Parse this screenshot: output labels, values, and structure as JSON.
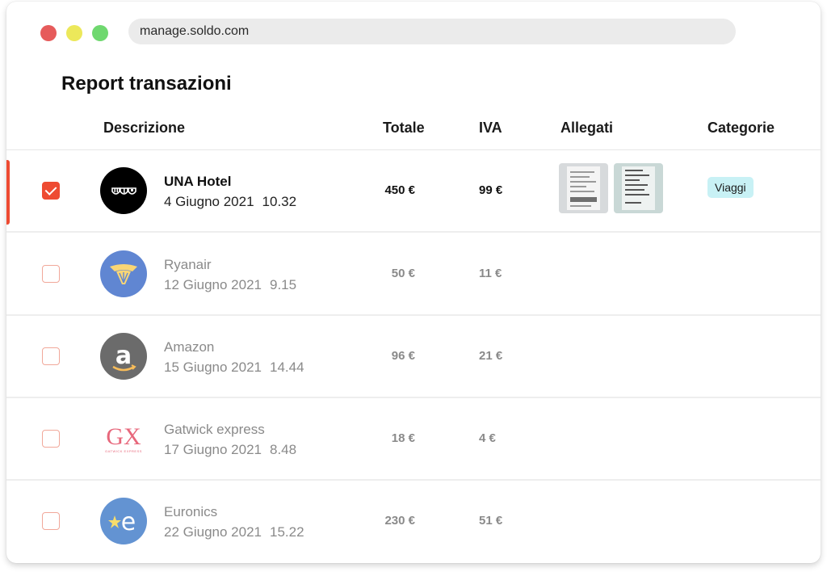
{
  "browser": {
    "url": "manage.soldo.com",
    "dots": {
      "red": "#e65b5b",
      "yellow": "#ece85a",
      "green": "#6fd86f"
    }
  },
  "page": {
    "title": "Report transazioni"
  },
  "table": {
    "headers": {
      "description": "Descrizione",
      "total": "Totale",
      "vat": "IVA",
      "attachments": "Allegati",
      "categories": "Categorie"
    },
    "rows": [
      {
        "merchant": "UNA Hotel",
        "date": "4 Giugno 2021",
        "time": "10.32",
        "total": "450 €",
        "vat": "99 €",
        "selected": true,
        "logo": "una-hotel-logo",
        "attachments": [
          "receipt-thumbnail",
          "receipt-thumbnail"
        ],
        "category": "Viaggi"
      },
      {
        "merchant": "Ryanair",
        "date": "12 Giugno 2021",
        "time": "9.15",
        "total": "50 €",
        "vat": "11 €",
        "selected": false,
        "logo": "ryanair-logo"
      },
      {
        "merchant": "Amazon",
        "date": "15 Giugno 2021",
        "time": "14.44",
        "total": "96 €",
        "vat": "21 €",
        "selected": false,
        "logo": "amazon-logo"
      },
      {
        "merchant": "Gatwick express",
        "date": "17 Giugno 2021",
        "time": "8.48",
        "total": "18 €",
        "vat": "4 €",
        "selected": false,
        "logo": "gatwick-express-logo",
        "logo_text": "GX",
        "logo_subtext": "GATWICK EXPRESS"
      },
      {
        "merchant": "Euronics",
        "date": "22 Giugno 2021",
        "time": "15.22",
        "total": "230 €",
        "vat": "51 €",
        "selected": false,
        "logo": "euronics-logo",
        "logo_text": "e"
      }
    ]
  },
  "colors": {
    "accent": "#ee4b32",
    "checkbox_border": "#f1a89a",
    "badge_bg": "#c8f1f5"
  }
}
